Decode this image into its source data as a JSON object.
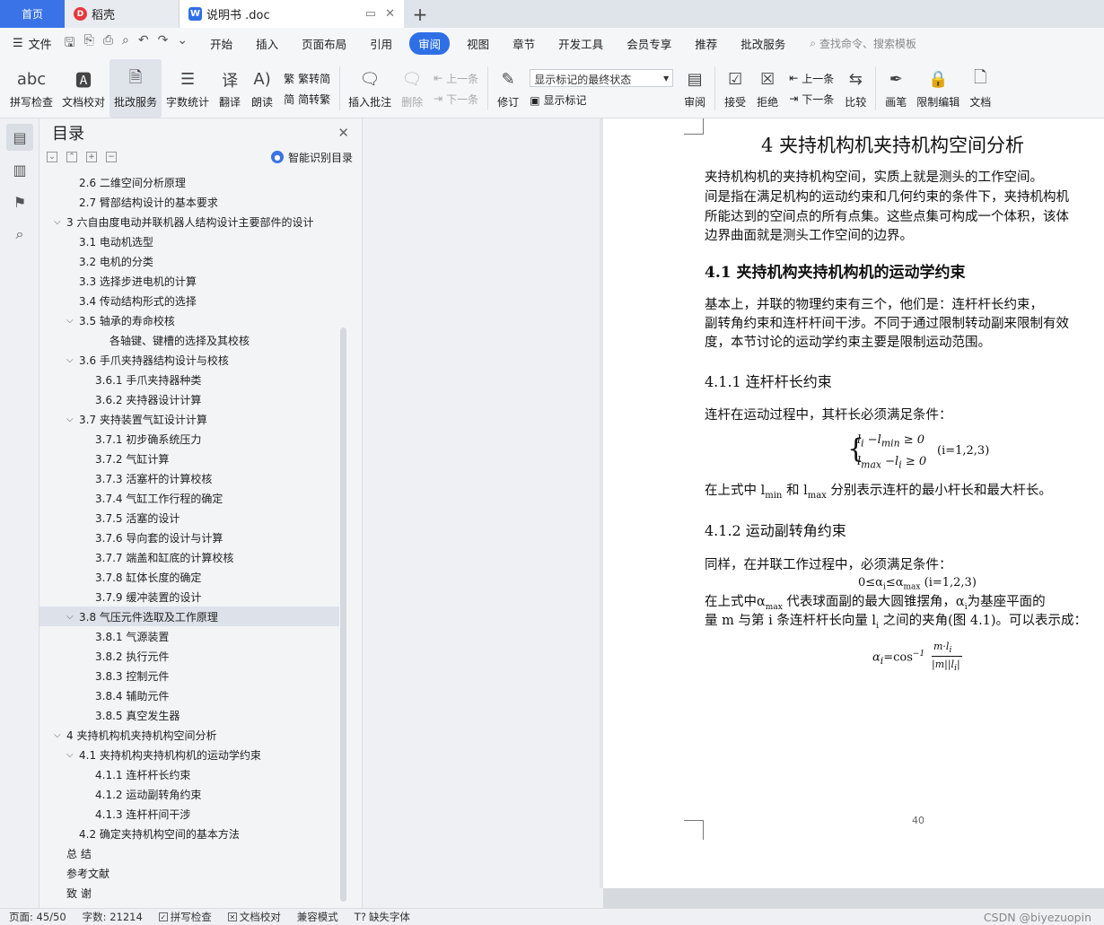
{
  "tabs": {
    "home": "首页",
    "daoke": "稻壳",
    "doc": "说明书 .doc"
  },
  "menu": {
    "file": "文件",
    "items": [
      "开始",
      "插入",
      "页面布局",
      "引用",
      "审阅",
      "视图",
      "章节",
      "开发工具",
      "会员专享",
      "推荐",
      "批改服务"
    ],
    "active": "审阅",
    "search": "查找命令、搜索模板"
  },
  "ribbon": {
    "spell": "拼写检查",
    "proof": "文档校对",
    "grading": "批改服务",
    "wordcount": "字数统计",
    "translate": "翻译",
    "read": "朗读",
    "trad": "繁转简",
    "simp": "简转繁",
    "insert_comment": "插入批注",
    "delete": "删除",
    "prev": "上一条",
    "next": "下一条",
    "revise": "修订",
    "markup_select": "显示标记的最终状态",
    "show_markup": "显示标记",
    "review": "审阅",
    "accept": "接受",
    "reject": "拒绝",
    "prev2": "上一条",
    "next2": "下一条",
    "compare": "比较",
    "pen": "画笔",
    "restrict": "限制编辑",
    "doc_rights": "文档"
  },
  "toc": {
    "title": "目录",
    "smart": "智能识别目录",
    "items": [
      {
        "text": "2.6 二维空间分析原理",
        "level": 2
      },
      {
        "text": "2.7 臂部结构设计的基本要求",
        "level": 2
      },
      {
        "text": "3  六自由度电动并联机器人结构设计主要部件的设计",
        "level": 1,
        "caret": true
      },
      {
        "text": "3.1 电动机选型",
        "level": 2
      },
      {
        "text": "3.2 电机的分类",
        "level": 2
      },
      {
        "text": "3.3 选择步进电机的计算",
        "level": 2
      },
      {
        "text": "3.4 传动结构形式的选择",
        "level": 2
      },
      {
        "text": "3.5 轴承的寿命校核",
        "level": 2,
        "caret": true
      },
      {
        "text": "各轴键、键槽的选择及其校核",
        "level": 4
      },
      {
        "text": "3.6 手爪夹持器结构设计与校核",
        "level": 2,
        "caret": true
      },
      {
        "text": "3.6.1 手爪夹持器种类",
        "level": 3
      },
      {
        "text": "3.6.2 夹持器设计计算",
        "level": 3
      },
      {
        "text": "3.7 夹持装置气缸设计计算",
        "level": 2,
        "caret": true
      },
      {
        "text": "3.7.1 初步确系统压力",
        "level": 3
      },
      {
        "text": "3.7.2 气缸计算",
        "level": 3
      },
      {
        "text": "3.7.3 活塞杆的计算校核",
        "level": 3
      },
      {
        "text": "3.7.4 气缸工作行程的确定",
        "level": 3
      },
      {
        "text": "3.7.5 活塞的设计",
        "level": 3
      },
      {
        "text": "3.7.6 导向套的设计与计算",
        "level": 3
      },
      {
        "text": "3.7.7 端盖和缸底的计算校核",
        "level": 3
      },
      {
        "text": "3.7.8 缸体长度的确定",
        "level": 3
      },
      {
        "text": "3.7.9 缓冲装置的设计",
        "level": 3
      },
      {
        "text": "3.8 气压元件选取及工作原理",
        "level": 2,
        "caret": true,
        "selected": true
      },
      {
        "text": "3.8.1 气源装置",
        "level": 3
      },
      {
        "text": "3.8.2 执行元件",
        "level": 3
      },
      {
        "text": "3.8.3 控制元件",
        "level": 3
      },
      {
        "text": "3.8.4 辅助元件",
        "level": 3
      },
      {
        "text": "3.8.5 真空发生器",
        "level": 3
      },
      {
        "text": "4  夹持机构机夹持机构空间分析",
        "level": 1,
        "caret": true
      },
      {
        "text": "4.1 夹持机构夹持机构机的运动学约束",
        "level": 2,
        "caret": true
      },
      {
        "text": "4.1.1 连杆杆长约束",
        "level": 3
      },
      {
        "text": "4.1.2 运动副转角约束",
        "level": 3
      },
      {
        "text": "4.1.3 连杆杆间干涉",
        "level": 3
      },
      {
        "text": "4.2 确定夹持机构空间的基本方法",
        "level": 2
      },
      {
        "text": "总  结",
        "level": 1
      },
      {
        "text": "参考文献",
        "level": 1
      },
      {
        "text": "致  谢",
        "level": 1
      }
    ]
  },
  "doc": {
    "h1": "4    夹持机构机夹持机构空间分析",
    "p1": [
      "    夹持机构机的夹持机构空间，实质上就是测头的工作空间。",
      "间是指在满足机构的运动约束和几何约束的条件下，夹持机构机",
      "所能达到的空间点的所有点集。这些点集可构成一个体积，该体",
      "边界曲面就是测头工作空间的边界。"
    ],
    "h2": "4.1 夹持机构夹持机构机的运动学约束",
    "p2": [
      "    基本上，并联的物理约束有三个，他们是：连杆杆长约束，",
      "副转角约束和连杆杆间干涉。不同于通过限制转动副来限制有效",
      "度，本节讨论的运动学约束主要是限制运动范围。"
    ],
    "h3a": "4.1.1  连杆杆长约束",
    "p3": "    连杆在运动过程中，其杆长必须满足条件：",
    "f1a": "l",
    "f1_cond": "(i=1,2,3)",
    "p4": "    在上式中 l",
    "p4_min": "min",
    "p4_mid": " 和 l",
    "p4_max": "max",
    "p4_end": " 分别表示连杆的最小杆长和最大杆长。",
    "h3b": "4.1.2  运动副转角约束",
    "p5": "    同样，在并联工作过程中，必须满足条件：",
    "f2": "0≤α",
    "f2_i": "i",
    "f2_mid": "≤α",
    "f2_max": "max",
    "f2_cond": " (i=1,2,3)",
    "p6a": "    在上式中α",
    "p6a_sub": "max",
    "p6a_end": " 代表球面副的最大圆锥摆角，α",
    "p6a_i": "i",
    "p6a_tail": "为基座平面的",
    "p6b": "量 m 与第 i 条连杆杆长向量 l",
    "p6b_i": "i",
    "p6b_end": " 之间的夹角(图 4.1)。可以表示成：",
    "f3_lhs": "α",
    "f3_eq": "=cos",
    "f3_num": "m·l",
    "f3_den": "|m||l",
    "page_number": "40"
  },
  "status": {
    "page": "页面: 45/50",
    "words": "字数: 21214",
    "spell": "拼写检查",
    "proof": "文档校对",
    "compat": "兼容模式",
    "missing_font": "缺失字体",
    "watermark": "CSDN @biyezuopin"
  }
}
